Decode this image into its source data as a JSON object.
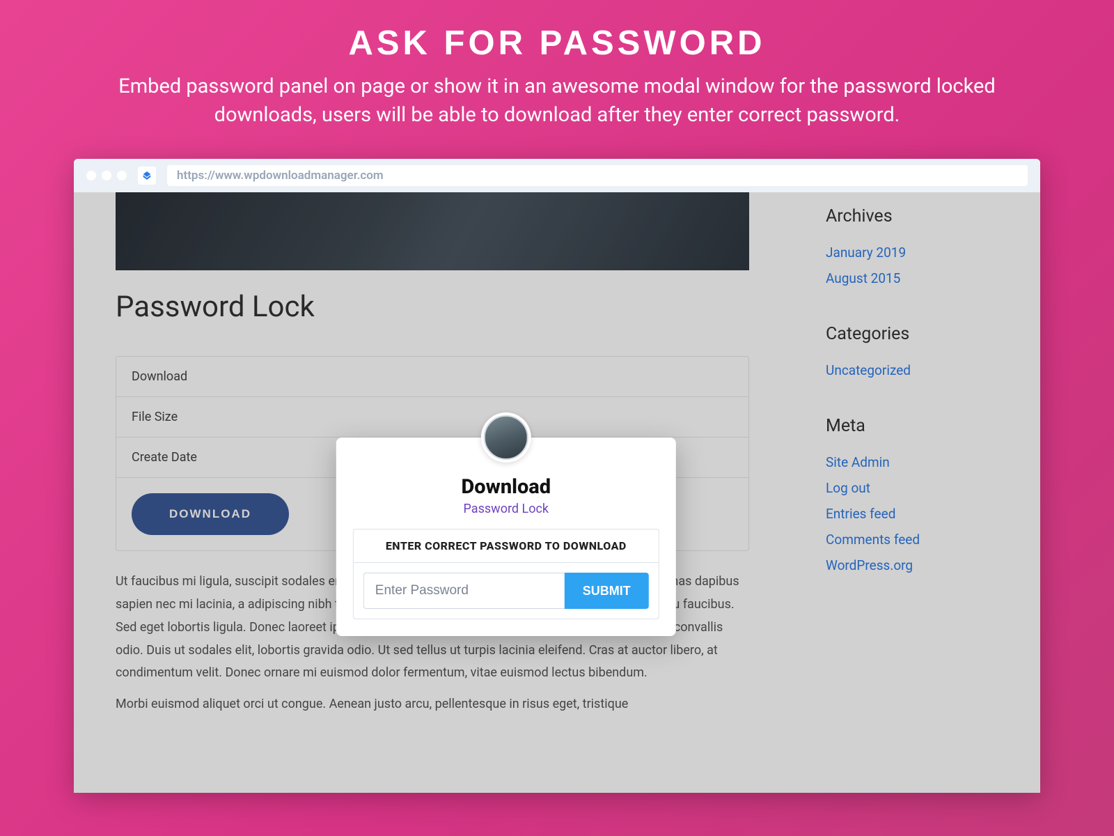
{
  "hero": {
    "title": "ASK FOR PASSWORD",
    "subtitle": "Embed password panel on page or show it in an awesome modal window for the password locked downloads, users will be able to download after they enter correct password."
  },
  "browser": {
    "url": "https://www.wpdownloadmanager.com"
  },
  "page": {
    "title": "Password Lock",
    "info_rows": [
      "Download",
      "File Size",
      "Create Date"
    ],
    "download_button": "DOWNLOAD",
    "lorem1": "Ut faucibus mi ligula, suscipit sodales eros lacinia at. Morbi elementum vulputate consequat. Maecenas dapibus sapien nec mi lacinia, a adipiscing nibh tincidunt. Fusce placerat leo vel purus pulvinar, ac feugiat arcu faucibus. Sed eget lobortis ligula. Donec laoreet ipsum et nisl ornare blandit. Etiam pretium posuere odio, eget convallis odio. Duis ut sodales elit, lobortis gravida odio. Ut sed tellus ut turpis lacinia eleifend. Cras at auctor libero, at condimentum velit. Donec ornare mi euismod dolor fermentum, vitae euismod lectus bibendum.",
    "lorem2": "Morbi euismod aliquet orci ut congue. Aenean justo arcu, pellentesque in risus eget, tristique"
  },
  "sidebar": {
    "archives": {
      "title": "Archives",
      "items": [
        "January 2019",
        "August 2015"
      ]
    },
    "categories": {
      "title": "Categories",
      "items": [
        "Uncategorized"
      ]
    },
    "meta": {
      "title": "Meta",
      "items": [
        "Site Admin",
        "Log out",
        "Entries feed",
        "Comments feed",
        "WordPress.org"
      ]
    }
  },
  "modal": {
    "title": "Download",
    "subtitle": "Password Lock",
    "panel_heading": "ENTER CORRECT PASSWORD TO DOWNLOAD",
    "placeholder": "Enter Password",
    "submit": "SUBMIT"
  }
}
